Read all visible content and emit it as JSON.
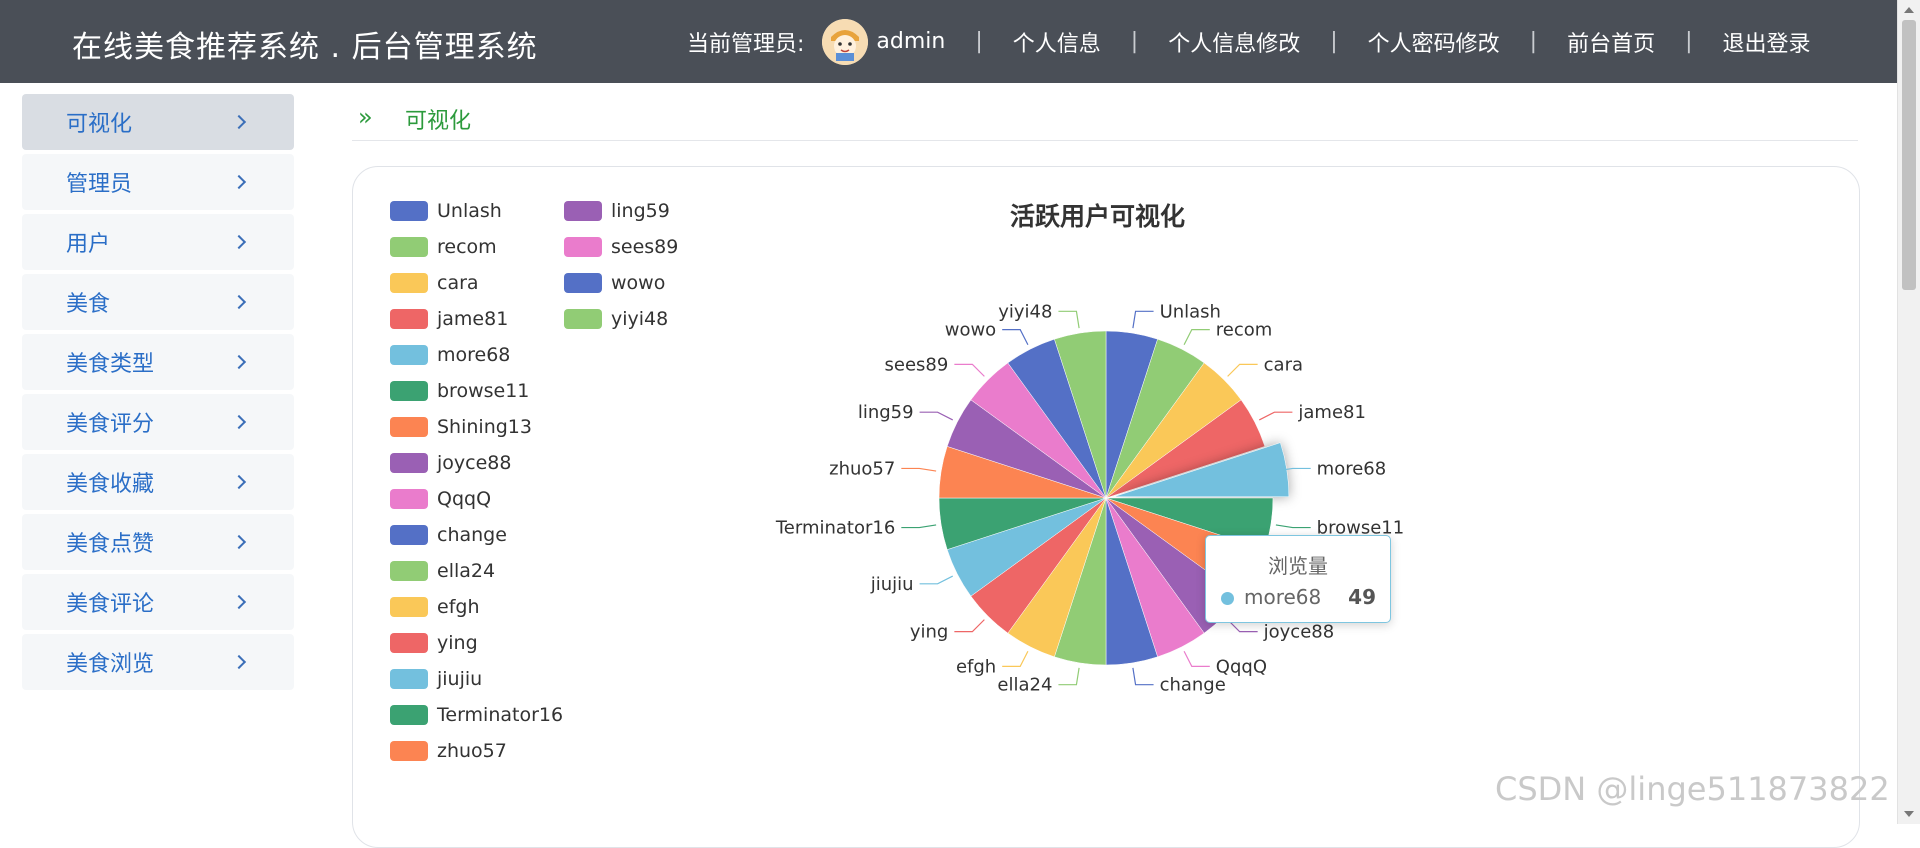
{
  "header": {
    "title": "在线美食推荐系统 . 后台管理系统",
    "admin_label": "当前管理员:",
    "username": "admin",
    "links": [
      "个人信息",
      "个人信息修改",
      "个人密码修改",
      "前台首页",
      "退出登录"
    ],
    "separator": "|"
  },
  "sidebar": {
    "items": [
      {
        "label": "可视化",
        "active": true
      },
      {
        "label": "管理员"
      },
      {
        "label": "用户"
      },
      {
        "label": "美食"
      },
      {
        "label": "美食类型"
      },
      {
        "label": "美食评分"
      },
      {
        "label": "美食收藏"
      },
      {
        "label": "美食点赞"
      },
      {
        "label": "美食评论"
      },
      {
        "label": "美食浏览"
      }
    ]
  },
  "breadcrumb": {
    "icon": "»",
    "current": "可视化"
  },
  "chart_data": {
    "type": "pie",
    "title": "活跃用户可视化",
    "series_name": "浏览量",
    "categories": [
      "Unlash",
      "recom",
      "cara",
      "jame81",
      "more68",
      "browse11",
      "Shining13",
      "joyce88",
      "QqqQ",
      "change",
      "ella24",
      "efgh",
      "ying",
      "jiujiu",
      "Terminator16",
      "zhuo57",
      "ling59",
      "sees89",
      "wowo",
      "yiyi48"
    ],
    "colors": [
      "#5470c6",
      "#91cc75",
      "#fac858",
      "#ee6666",
      "#73c0de",
      "#3ba272",
      "#fc8452",
      "#9a60b4",
      "#ea7ccc",
      "#5470c6",
      "#91cc75",
      "#fac858",
      "#ee6666",
      "#73c0de",
      "#3ba272",
      "#fc8452",
      "#9a60b4",
      "#ea7ccc",
      "#5470c6",
      "#91cc75"
    ],
    "values": [
      49,
      49,
      49,
      49,
      49,
      49,
      49,
      49,
      49,
      49,
      49,
      49,
      49,
      49,
      49,
      49,
      49,
      49,
      49,
      49
    ],
    "highlighted": "more68",
    "legend_position": "top-left",
    "tooltip": {
      "title": "浏览量",
      "name": "more68",
      "value": "49"
    }
  },
  "watermark": "CSDN @linge511873822"
}
